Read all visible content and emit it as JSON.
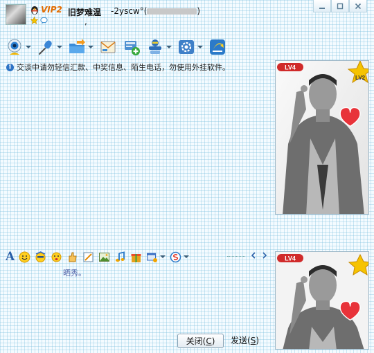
{
  "header": {
    "vip_badge": "VIP2",
    "nickname": "旧梦难温",
    "account_prefix": "-2yscw°(",
    "account_suffix": ")",
    "signature": ","
  },
  "toolbar": {
    "items": [
      "video-call",
      "voice-call",
      "send-file",
      "send-email",
      "create-group",
      "app-center",
      "settings",
      "remote-assist"
    ]
  },
  "notice": {
    "text": "交谈中请勿轻信汇款、中奖信息、陌生电话，勿使用外挂软件。"
  },
  "input_toolbar": {
    "font_label": "A"
  },
  "input": {
    "text": "晒秀。"
  },
  "photos": {
    "top_badge_left": "LV4",
    "top_badge_right": "LV2",
    "bottom_badge_left": "LV4"
  },
  "buttons": {
    "close_label": "关闭",
    "close_key": "C",
    "send_label": "发送",
    "send_key": "S"
  }
}
